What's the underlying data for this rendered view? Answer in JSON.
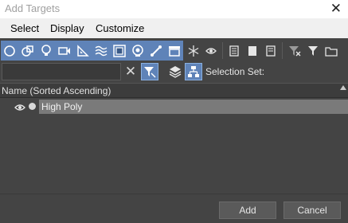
{
  "window": {
    "title": "Add Targets",
    "close_glyph": "✕"
  },
  "menu": [
    "Select",
    "Display",
    "Customize"
  ],
  "toolbar": {
    "buttons": [
      "geometry-sphere-icon",
      "shapes-icon",
      "lights-icon",
      "cameras-icon",
      "helpers-icon",
      "spacewarps-icon",
      "groups-icon",
      "xrefs-icon",
      "bones-icon",
      "containers-icon",
      "frozen-icon",
      "hidden-icon",
      "columns-icon",
      "column2-icon",
      "column3-icon",
      "filter-funnel-x-icon",
      "filter-funnel-icon",
      "folder-icon"
    ],
    "accent": "#5f83b8"
  },
  "filter": {
    "search_value": "",
    "clear_glyph": "✕",
    "selection_set_label": "Selection Set:"
  },
  "list": {
    "header": "Name (Sorted Ascending)",
    "items": [
      {
        "name": "High Poly",
        "selected": true
      }
    ]
  },
  "footer": {
    "add_label": "Add",
    "cancel_label": "Cancel"
  }
}
